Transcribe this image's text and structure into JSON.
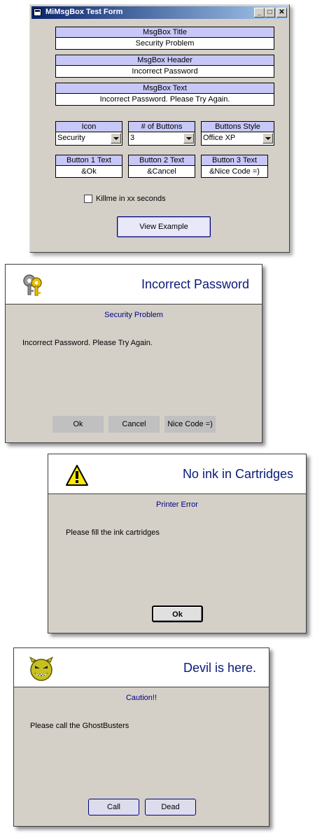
{
  "form": {
    "title": "MiMsgBox Test Form",
    "min_glyph": "_",
    "max_glyph": "□",
    "close_glyph": "✕",
    "msgbox_title": {
      "label": "MsgBox Title",
      "value": "Security Problem"
    },
    "msgbox_header": {
      "label": "MsgBox Header",
      "value": "Incorrect Password"
    },
    "msgbox_text": {
      "label": "MsgBox Text",
      "value": "Incorrect Password. Please Try Again."
    },
    "icon": {
      "label": "Icon",
      "value": "Security"
    },
    "num_buttons": {
      "label": "# of Buttons",
      "value": "3"
    },
    "buttons_style": {
      "label": "Buttons Style",
      "value": "Office XP"
    },
    "button1": {
      "label": "Button 1 Text",
      "value": "&Ok"
    },
    "button2": {
      "label": "Button 2 Text",
      "value": "&Cancel"
    },
    "button3": {
      "label": "Button 3 Text",
      "value": "&Nice Code =)"
    },
    "killme_label": "Killme in xx seconds",
    "view_button": "View Example"
  },
  "msgbox1": {
    "icon": "keys-icon",
    "header": "Incorrect Password",
    "title": "Security Problem",
    "text": "Incorrect Password. Please Try Again.",
    "buttons": [
      "Ok",
      "Cancel",
      "Nice Code =)"
    ]
  },
  "msgbox2": {
    "icon": "warning-icon",
    "header": "No ink in Cartridges",
    "title": "Printer Error",
    "text": "Please fill the ink cartridges",
    "buttons": [
      "Ok"
    ]
  },
  "msgbox3": {
    "icon": "devil-face-icon",
    "header": "Devil is here.",
    "title": "Caution!!",
    "text": "Please call the GhostBusters",
    "buttons": [
      "Call",
      "Dead"
    ]
  },
  "colors": {
    "title_gradient_start": "#0a246a",
    "label_band": "#c8c8f8",
    "header_text": "#0a1a7a",
    "subtitle_text": "#000080"
  }
}
